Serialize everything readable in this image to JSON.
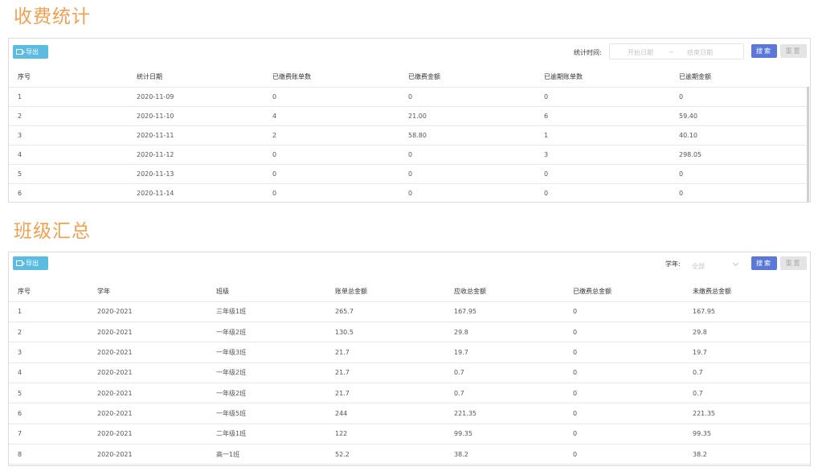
{
  "fee_stats": {
    "title": "收费统计",
    "export_label": "导出",
    "time_label": "统计时间:",
    "start_placeholder": "开始日期",
    "range_sep": "~",
    "end_placeholder": "结束日期",
    "search_label": "搜索",
    "reset_label": "重置",
    "columns": [
      "序号",
      "统计日期",
      "已缴费账单数",
      "已缴费金额",
      "已逾期账单数",
      "已逾期金额"
    ],
    "rows": [
      [
        "1",
        "2020-11-09",
        "0",
        "0",
        "0",
        "0"
      ],
      [
        "2",
        "2020-11-10",
        "4",
        "21.00",
        "6",
        "59.40"
      ],
      [
        "3",
        "2020-11-11",
        "2",
        "58.80",
        "1",
        "40.10"
      ],
      [
        "4",
        "2020-11-12",
        "0",
        "0",
        "3",
        "298.05"
      ],
      [
        "5",
        "2020-11-13",
        "0",
        "0",
        "0",
        "0"
      ],
      [
        "6",
        "2020-11-14",
        "0",
        "0",
        "0",
        "0"
      ]
    ]
  },
  "class_summary": {
    "title": "班级汇总",
    "export_label": "导出",
    "year_label": "学年:",
    "year_value": "全部",
    "search_label": "搜索",
    "reset_label": "重置",
    "columns": [
      "序号",
      "学年",
      "班级",
      "账单总金额",
      "应收总金额",
      "已缴费总金额",
      "未缴费总金额"
    ],
    "rows": [
      [
        "1",
        "2020-2021",
        "三年级1班",
        "265.7",
        "167.95",
        "0",
        "167.95"
      ],
      [
        "2",
        "2020-2021",
        "一年级2班",
        "130.5",
        "29.8",
        "0",
        "29.8"
      ],
      [
        "3",
        "2020-2021",
        "一年级3班",
        "21.7",
        "19.7",
        "0",
        "19.7"
      ],
      [
        "4",
        "2020-2021",
        "一年级2班",
        "21.7",
        "0.7",
        "0",
        "0.7"
      ],
      [
        "5",
        "2020-2021",
        "一年级2班",
        "21.7",
        "0.7",
        "0",
        "0.7"
      ],
      [
        "6",
        "2020-2021",
        "一年级5班",
        "244",
        "221.35",
        "0",
        "221.35"
      ],
      [
        "7",
        "2020-2021",
        "二年级1班",
        "122",
        "99.35",
        "0",
        "99.35"
      ],
      [
        "8",
        "2020-2021",
        "高一1班",
        "52.2",
        "38.2",
        "0",
        "38.2"
      ]
    ]
  },
  "colors": {
    "title": "#f0a050",
    "export_button": "#5bbbe0",
    "search_button": "#5a78d8",
    "reset_button": "#e4e4e4"
  }
}
